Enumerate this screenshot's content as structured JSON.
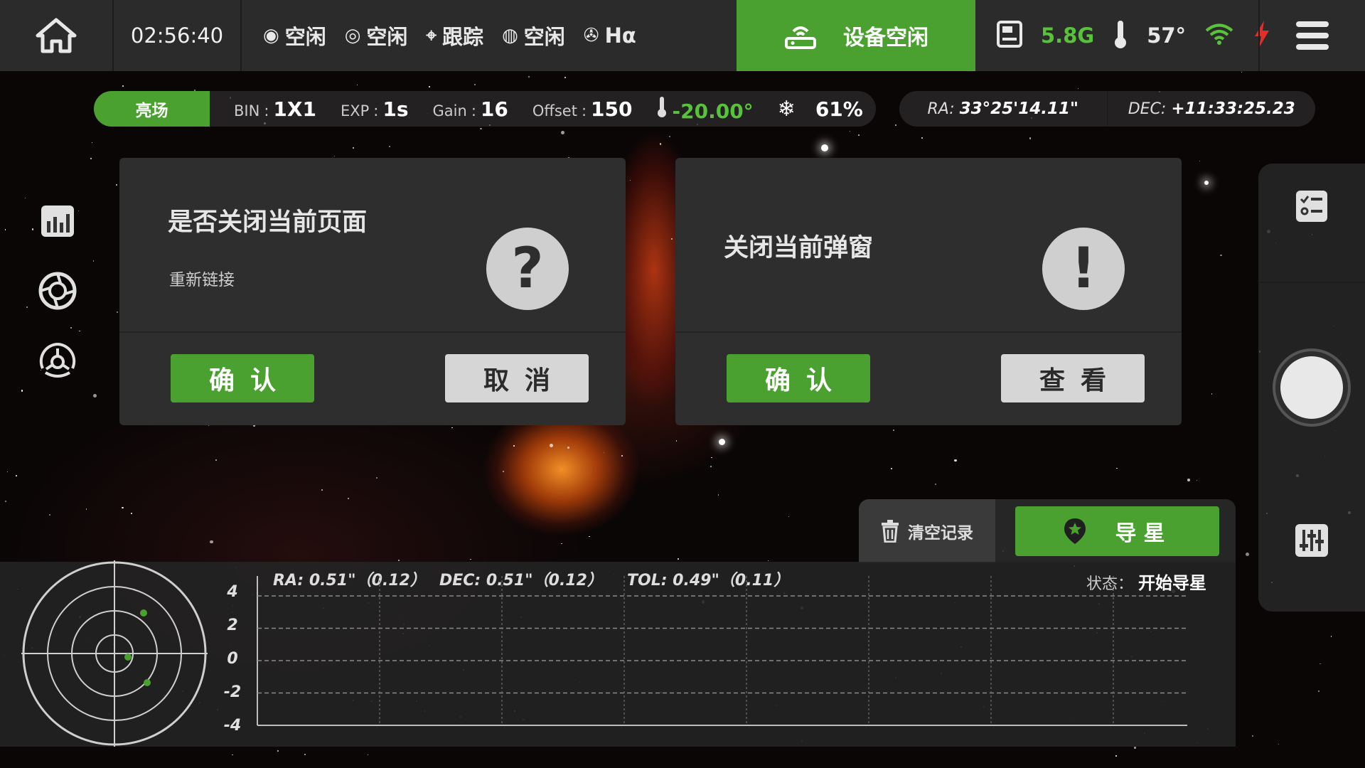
{
  "topbar": {
    "time": "02:56:40",
    "status_items": [
      {
        "icon": "camera-icon",
        "label": "空闲"
      },
      {
        "icon": "guide-camera-icon",
        "label": "空闲"
      },
      {
        "icon": "telescope-icon",
        "label": "跟踪"
      },
      {
        "icon": "focuser-icon",
        "label": "空闲"
      },
      {
        "icon": "filter-wheel-icon",
        "label": "Hα"
      }
    ],
    "device_status": "设备空闲",
    "storage": "5.8G",
    "temperature": "57°"
  },
  "info_strip": {
    "mode": "亮场",
    "bin_label": "BIN",
    "bin_value": "1X1",
    "exp_label": "EXP",
    "exp_value": "1s",
    "gain_label": "Gain",
    "gain_value": "16",
    "offset_label": "Offset",
    "offset_value": "150",
    "sensor_temp": "-20.00°",
    "cooler_power": "61%"
  },
  "coords": {
    "ra_label": "RA:",
    "ra_value": "33°25'14.11\"",
    "dec_label": "DEC:",
    "dec_value": "+11:33:25.23"
  },
  "dialog_left": {
    "title": "是否关闭当前页面",
    "subtitle": "重新链接",
    "badge": "?",
    "confirm": "确认",
    "cancel": "取消"
  },
  "dialog_right": {
    "title": "关闭当前弹窗",
    "badge": "!",
    "confirm": "确认",
    "view": "查看"
  },
  "guide": {
    "clear": "清空记录",
    "start": "导星",
    "ra_stat": "RA: 0.51\"（0.12）",
    "dec_stat": "DEC: 0.51\"（0.12）",
    "tol_stat": "TOL: 0.49\"（0.11）",
    "state_label": "状态：",
    "state_value": "开始导星"
  },
  "chart_data": {
    "type": "line",
    "yticks": [
      "4",
      "2",
      "0",
      "-2",
      "-4"
    ],
    "ylim": [
      -4,
      4
    ],
    "series": []
  },
  "colors": {
    "accent_green": "#4aa12f",
    "status_green": "#58c33a",
    "warning_red": "#e0302a"
  }
}
